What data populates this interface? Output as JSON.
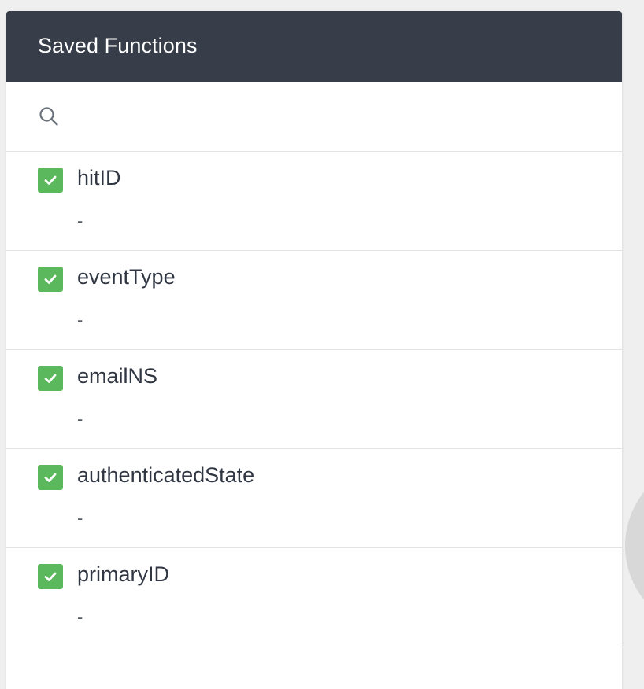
{
  "panel": {
    "title": "Saved Functions"
  },
  "search": {
    "value": "",
    "placeholder": "",
    "icon": "search-icon"
  },
  "items": [
    {
      "label": "hitID",
      "description": "-",
      "checked": true
    },
    {
      "label": "eventType",
      "description": "-",
      "checked": true
    },
    {
      "label": "emailNS",
      "description": "-",
      "checked": true
    },
    {
      "label": "authenticatedState",
      "description": "-",
      "checked": true
    },
    {
      "label": "primaryID",
      "description": "-",
      "checked": true
    }
  ],
  "colors": {
    "header_bg": "#373e49",
    "checkbox_green": "#5cb85c",
    "text_dark": "#303642",
    "divider": "#e3e3e3"
  }
}
